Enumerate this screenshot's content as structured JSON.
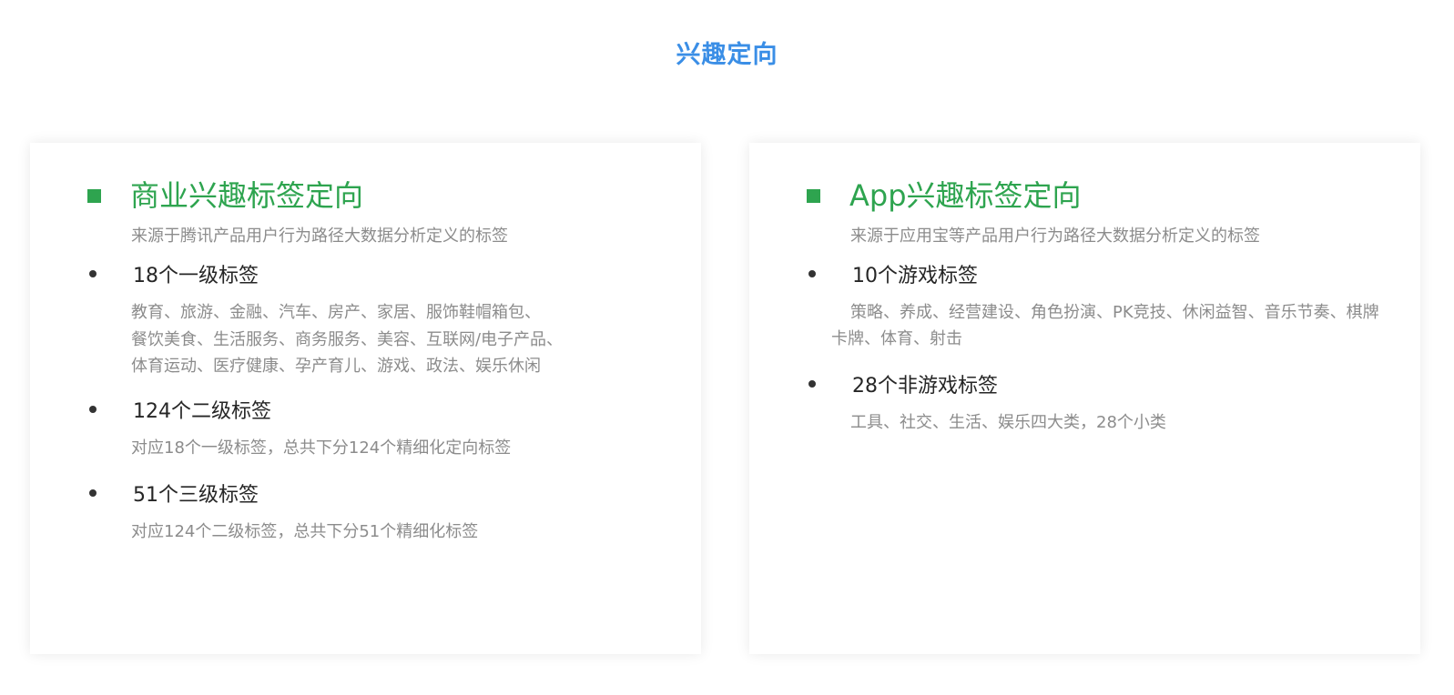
{
  "page_title": "兴趣定向",
  "left_card": {
    "title": "商业兴趣标签定向",
    "subtitle": "来源于腾讯产品用户行为路径大数据分析定义的标签",
    "items": [
      {
        "label": "18个一级标签",
        "desc_lines": [
          "教育、旅游、金融、汽车、房产、家居、服饰鞋帽箱包、",
          "餐饮美食、生活服务、商务服务、美容、互联网/电子产品、",
          "体育运动、医疗健康、孕产育儿、游戏、政法、娱乐休闲"
        ]
      },
      {
        "label": "124个二级标签",
        "desc_lines": [
          "对应18个一级标签，总共下分124个精细化定向标签"
        ]
      },
      {
        "label": "51个三级标签",
        "desc_lines": [
          "对应124个二级标签，总共下分51个精细化标签"
        ]
      }
    ]
  },
  "right_card": {
    "title": "App兴趣标签定向",
    "subtitle": "来源于应用宝等产品用户行为路径大数据分析定义的标签",
    "items": [
      {
        "label": "10个游戏标签",
        "desc_lines": [
          "策略、养成、经营建设、角色扮演、PK竞技、休闲益智、音乐节奏、棋牌",
          "卡牌、体育、射击"
        ]
      },
      {
        "label": "28个非游戏标签",
        "desc_lines": [
          "工具、社交、生活、娱乐四大类，28个小类"
        ]
      }
    ]
  },
  "colors": {
    "title_blue": "#3a8ee6",
    "accent_green": "#2ea44f",
    "desc_gray": "#8c8c8c"
  }
}
